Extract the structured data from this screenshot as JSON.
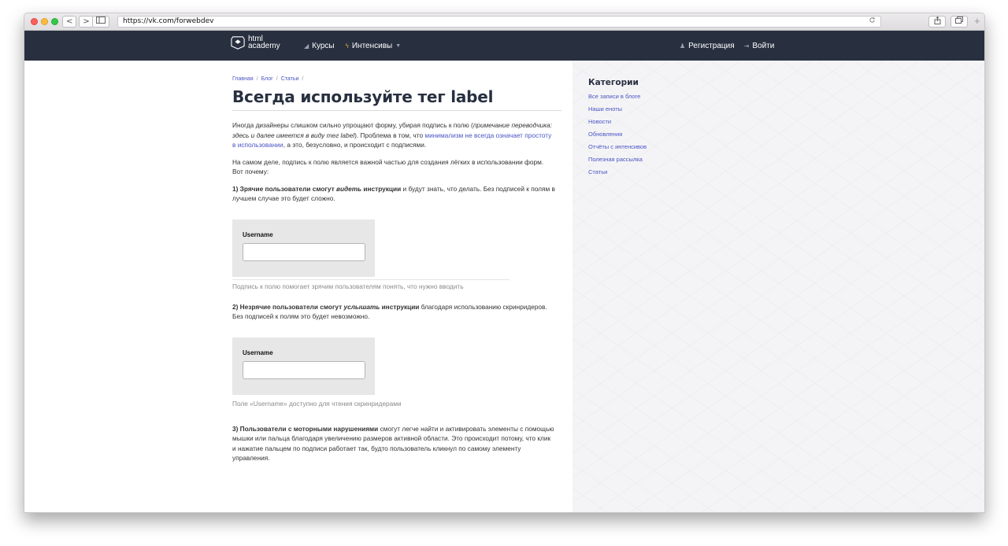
{
  "browser": {
    "url": "https://vk.com/forwebdev",
    "back": "<",
    "forward": ">",
    "reload_icon": "reload-icon",
    "plus": "+"
  },
  "header": {
    "logo_line1": "html",
    "logo_line2": "academy",
    "nav": [
      {
        "label": "Курсы",
        "icon": "chart-icon"
      },
      {
        "label": "Интенсивы",
        "icon": "bolt-icon"
      }
    ],
    "register_label": "Регистрация",
    "login_label": "Войти",
    "colors": {
      "header_bg": "#283040",
      "link": "#4a54c4"
    }
  },
  "breadcrumbs": {
    "home": "Главная",
    "blog": "Блог",
    "articles": "Статьи",
    "sep": "/"
  },
  "article": {
    "title": "Всегда используйте тег label",
    "p1": {
      "a": "Иногда дизайнеры слишком сильно упрощают форму, убирая подпись к полю (",
      "note": "примечание переводчика: здесь и далее имеется в виду тег label",
      "b": "). Проблема в том, что ",
      "link": "минимализм не всегда означает простоту в использовании",
      "c": ", а это, безусловно, и происходит с подписями."
    },
    "p2": "На самом деле, подпись к полю является важной частью для создания лёгких в использовании форм. Вот почему:",
    "p3": {
      "bold1": "1) Зрячие пользователи смогут ",
      "bold_it": "видеть",
      "bold2": " инструкции",
      "rest": " и будут знать, что делать. Без подписей к полям в лучшем случае это будет сложно."
    },
    "demo1_label": "Username",
    "caption1": "Подпись к полю помогает зрячим пользователям понять, что нужно вводить",
    "p4": {
      "bold1": "2) Незрячие пользователи смогут ",
      "bold_it": "услышать",
      "bold2": " инструкции",
      "rest": " благодаря использованию скринридеров. Без подписей к полям это будет невозможно."
    },
    "demo2_label": "Username",
    "caption2": "Поле «Username» доступно для чтения скринридерами",
    "p5": {
      "bold": "3) Пользователи с моторными нарушениями",
      "rest": " смогут легче найти и активировать элементы с помощью мышки или пальца благодаря увеличению размеров активной области. Это происходит потому, что клик и нажатие пальцем по подписи работает так, будто пользователь кликнул по самому элементу управления."
    }
  },
  "sidebar": {
    "title": "Категории",
    "categories": [
      "Все записи в блоге",
      "Наши еноты",
      "Новости",
      "Обновления",
      "Отчёты с интенсивов",
      "Полезная рассылка",
      "Статьи"
    ]
  }
}
